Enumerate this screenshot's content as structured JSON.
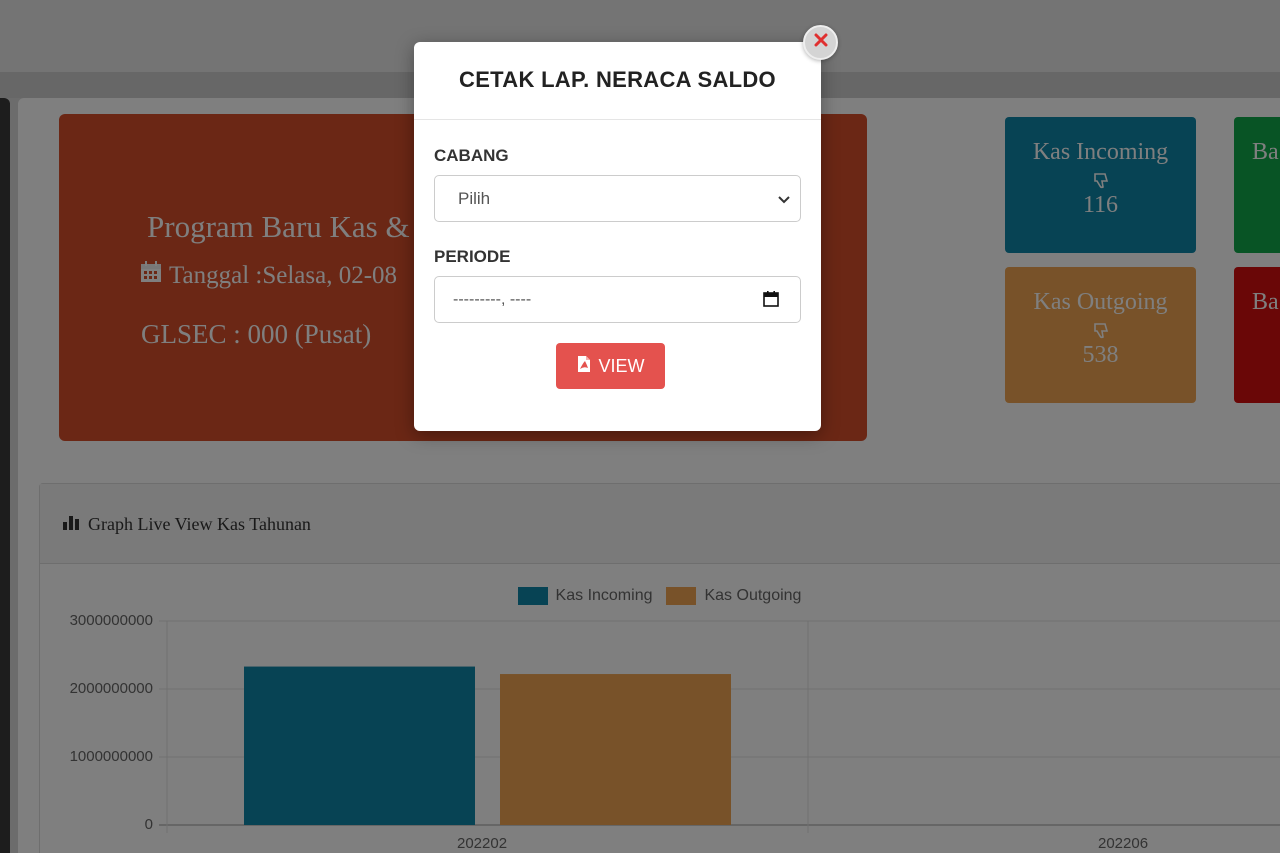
{
  "modal": {
    "title": "CETAK LAP. NERACA SALDO",
    "cabang_label": "CABANG",
    "cabang_value": "Pilih",
    "periode_label": "PERIODE",
    "periode_value": "---------, ----",
    "view_label": "VIEW"
  },
  "welcome": {
    "title": "Program Baru Kas &",
    "date": "Tanggal :Selasa, 02-08",
    "gl": "GLSEC : 000 (Pusat)"
  },
  "cards": {
    "kas_incoming": {
      "title": "Kas Incoming",
      "value": "116"
    },
    "kas_outgoing": {
      "title": "Kas Outgoing",
      "value": "538"
    },
    "bank_in": {
      "title": "Ba"
    },
    "bank_out": {
      "title": "Ba"
    }
  },
  "graph": {
    "title": "Graph Live View Kas Tahunan"
  },
  "colors": {
    "kas_incoming": "#0f87a8",
    "kas_outgoing": "#f0a552",
    "welcome": "#d64e2a",
    "view_button": "#e4524e",
    "close_icon": "#e03030"
  },
  "chart_data": {
    "type": "bar",
    "categories": [
      "202202",
      "202206"
    ],
    "series": [
      {
        "name": "Kas Incoming",
        "values": [
          2330000000,
          null
        ]
      },
      {
        "name": "Kas Outgoing",
        "values": [
          2220000000,
          null
        ]
      }
    ],
    "yticks": [
      "3000000000",
      "2000000000",
      "1000000000",
      "0"
    ],
    "ylim": [
      0,
      3000000000
    ],
    "legend": "top-center",
    "grid": true
  }
}
